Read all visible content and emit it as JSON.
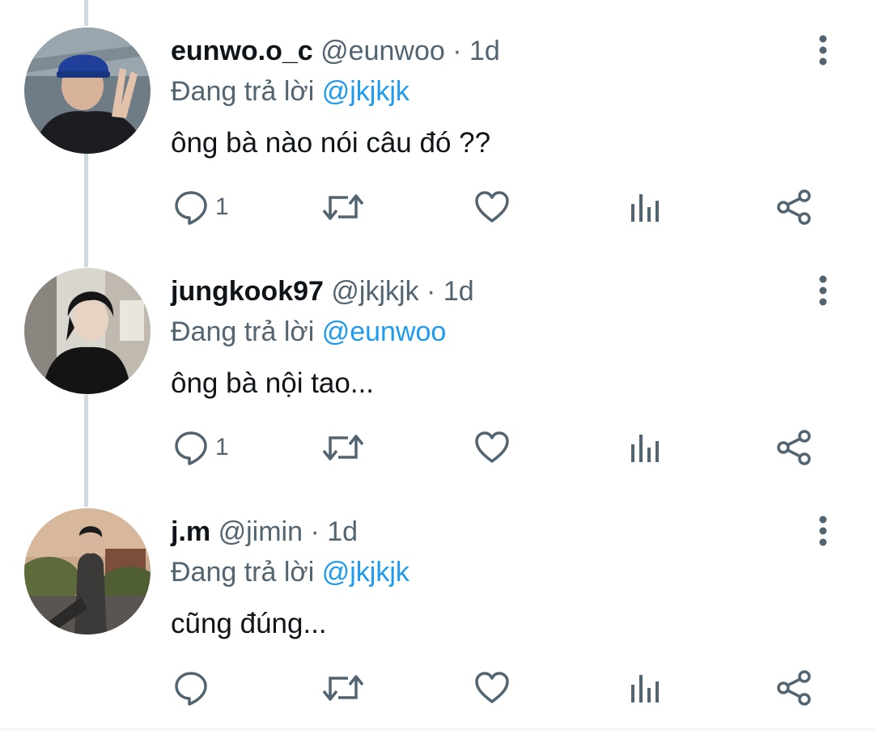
{
  "reply_prefix": "Đang trả lời",
  "icons": {
    "reply": "comment-bubble-icon",
    "retweet": "retweet-icon",
    "like": "heart-icon",
    "views": "bar-chart-icon",
    "share": "share-icon",
    "more": "more-vertical-icon"
  },
  "colors": {
    "link": "#1d9bf0",
    "secondary_text": "#536471",
    "primary_text": "#0f1419",
    "thread_line": "#cfd9de"
  },
  "tweets": [
    {
      "display_name": "eunwo.o_c",
      "handle": "@eunwoo",
      "separator": "·",
      "time": "1d",
      "reply_to": "@jkjkjk",
      "text": "ông bà nào nói câu đó ??",
      "reply_count": "1"
    },
    {
      "display_name": "jungkook97",
      "handle": "@jkjkjk",
      "separator": "·",
      "time": "1d",
      "reply_to": "@eunwoo",
      "text": "ông bà nội tao...",
      "reply_count": "1"
    },
    {
      "display_name": "j.m",
      "handle": "@jimin",
      "separator": "·",
      "time": "1d",
      "reply_to": "@jkjkjk",
      "text": "cũng đúng...",
      "reply_count": ""
    }
  ]
}
